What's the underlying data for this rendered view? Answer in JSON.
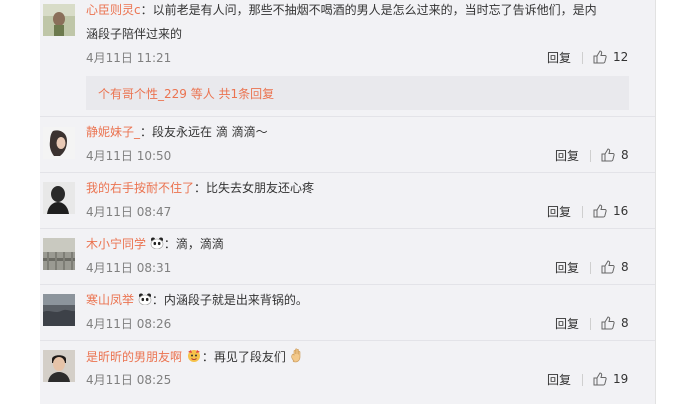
{
  "comments": [
    {
      "user": "心臣则灵c",
      "text": "：以前老是有人问，那些不抽烟不喝酒的男人是怎么过来的，当时忘了告诉他们，是内",
      "text2": "涵段子陪伴过来的",
      "time": "4月11日 11:21",
      "reply_label": "回复",
      "likes": "12",
      "sub_replies": "个有哥个性_229 等人 共1条回复"
    },
    {
      "user": "静妮妹子_",
      "text": "：段友永远在 滴 滴滴～",
      "time": "4月11日 10:50",
      "reply_label": "回复",
      "likes": "8"
    },
    {
      "user": "我的右手按耐不住了",
      "text": "：比失去女朋友还心疼",
      "time": "4月11日 08:47",
      "reply_label": "回复",
      "likes": "16"
    },
    {
      "user": "木小宁同学",
      "text": "：滴，滴滴",
      "time": "4月11日 08:31",
      "reply_label": "回复",
      "likes": "8"
    },
    {
      "user": "寒山凤举",
      "text": "：内涵段子就是出来背锅的。",
      "time": "4月11日 08:26",
      "reply_label": "回复",
      "likes": "8"
    },
    {
      "user": "是昕昕的男朋友啊",
      "text": "：再见了段友们",
      "time": "4月11日 08:25",
      "reply_label": "回复",
      "likes": "19"
    }
  ],
  "colors": {
    "username": "#eb7350",
    "meta": "#808080",
    "panel": "#f2f2f5"
  }
}
